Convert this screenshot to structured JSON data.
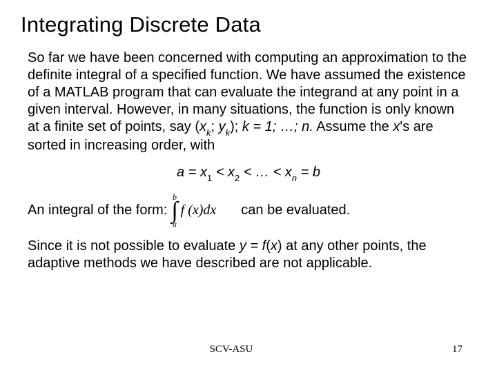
{
  "title": "Integrating Discrete Data",
  "p1_a": "So far we have been concerned with computing an approximation to the definite integral of a specified function. We have assumed the existence of a MATLAB program that can evaluate the integrand at any point in a given interval. However, in many situations, the function is only known at a finite set of points, say (",
  "p1_xk": "x",
  "p1_k1": "k",
  "p1_semi": "; ",
  "p1_yk": "y",
  "p1_k2": "k",
  "p1_b": "); ",
  "p1_kdef": "k = 1; …; n.",
  "p1_c": " Assume the ",
  "p1_x": "x",
  "p1_d": "'s are sorted in increasing order, with",
  "eq_a": "a = x",
  "eq_s1": "1",
  "eq_lt1": " < x",
  "eq_s2": "2",
  "eq_lt2": " < … < x",
  "eq_sn": "n",
  "eq_b": " = b",
  "p2_a": "An integral of the form:",
  "int_upper": "b",
  "int_lower": "a",
  "int_expr": "f (x)dx",
  "p2_b": "can be evaluated.",
  "p3_a": "Since it is not possible to evaluate ",
  "p3_eq": "y = f",
  "p3_paren": "(",
  "p3_x": "x",
  "p3_close": ")",
  "p3_b": " at any other points, the adaptive methods we have described are not applicable.",
  "footer_center": "SCV-ASU",
  "footer_right": "17"
}
